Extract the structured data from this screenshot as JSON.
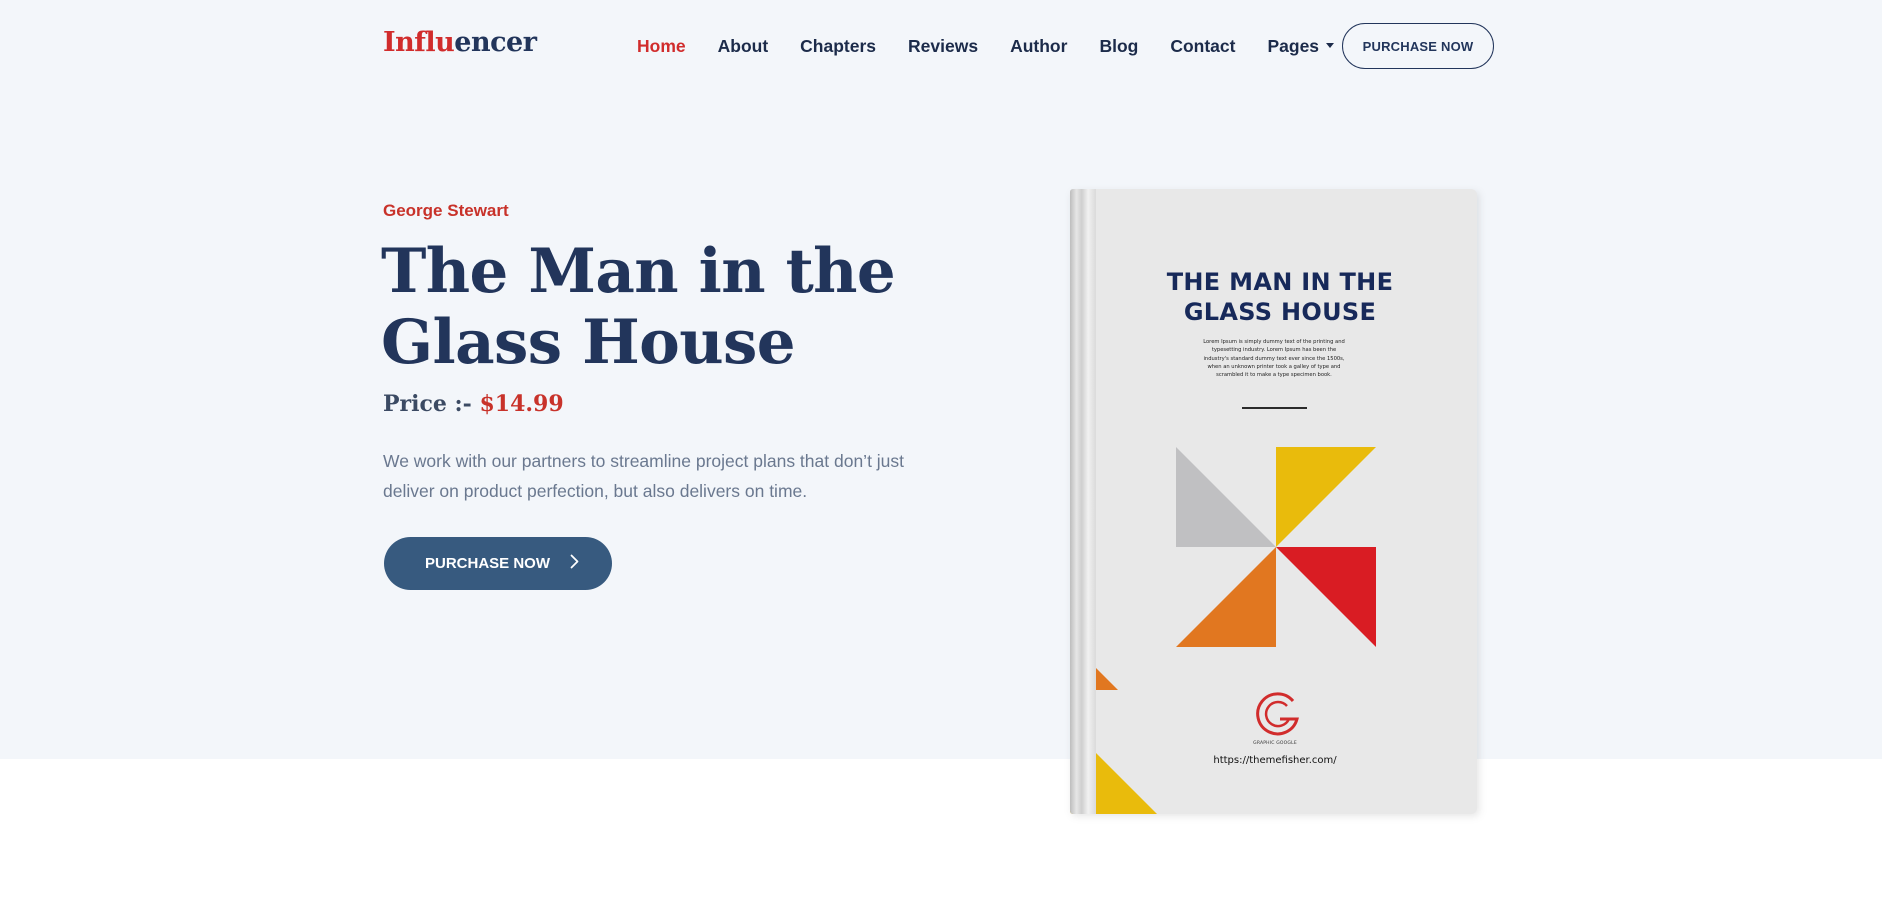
{
  "brand": {
    "logo_part1": "Influ",
    "logo_part2": "encer"
  },
  "nav": {
    "items": [
      {
        "label": "Home",
        "active": true
      },
      {
        "label": "About"
      },
      {
        "label": "Chapters"
      },
      {
        "label": "Reviews"
      },
      {
        "label": "Author"
      },
      {
        "label": "Blog"
      },
      {
        "label": "Contact"
      },
      {
        "label": "Pages",
        "dropdown": true
      }
    ],
    "cta_label": "PURCHASE NOW"
  },
  "hero": {
    "author": "George Stewart",
    "title": "The Man in the Glass House",
    "price_label": "Price :- ",
    "price": "$14.99",
    "description": "We work with our partners to streamline project plans that don’t just deliver on product perfection, but also delivers on time.",
    "cta_label": "PURCHASE NOW",
    "cta_icon": "chevron-right-icon"
  },
  "book": {
    "cover_title": "THE MAN IN THE GLASS HOUSE",
    "blurb": "Lorem Ipsum is simply dummy text of the printing and typesetting industry. Lorem Ipsum has been the industry's standard dummy text ever since the 1500s, when an unknown printer took a galley of type and scrambled it to make a type specimen book.",
    "publisher": "GRAPHIC GOOGLE",
    "url": "https://themefisher.com/"
  },
  "colors": {
    "accent_red": "#d12c2c",
    "navy": "#22355b",
    "button_blue": "#375a7f",
    "hero_bg": "#f3f6fa",
    "pinwheel": [
      "#c0c0c2",
      "#e9bb0c",
      "#d91c23",
      "#e17720"
    ]
  }
}
